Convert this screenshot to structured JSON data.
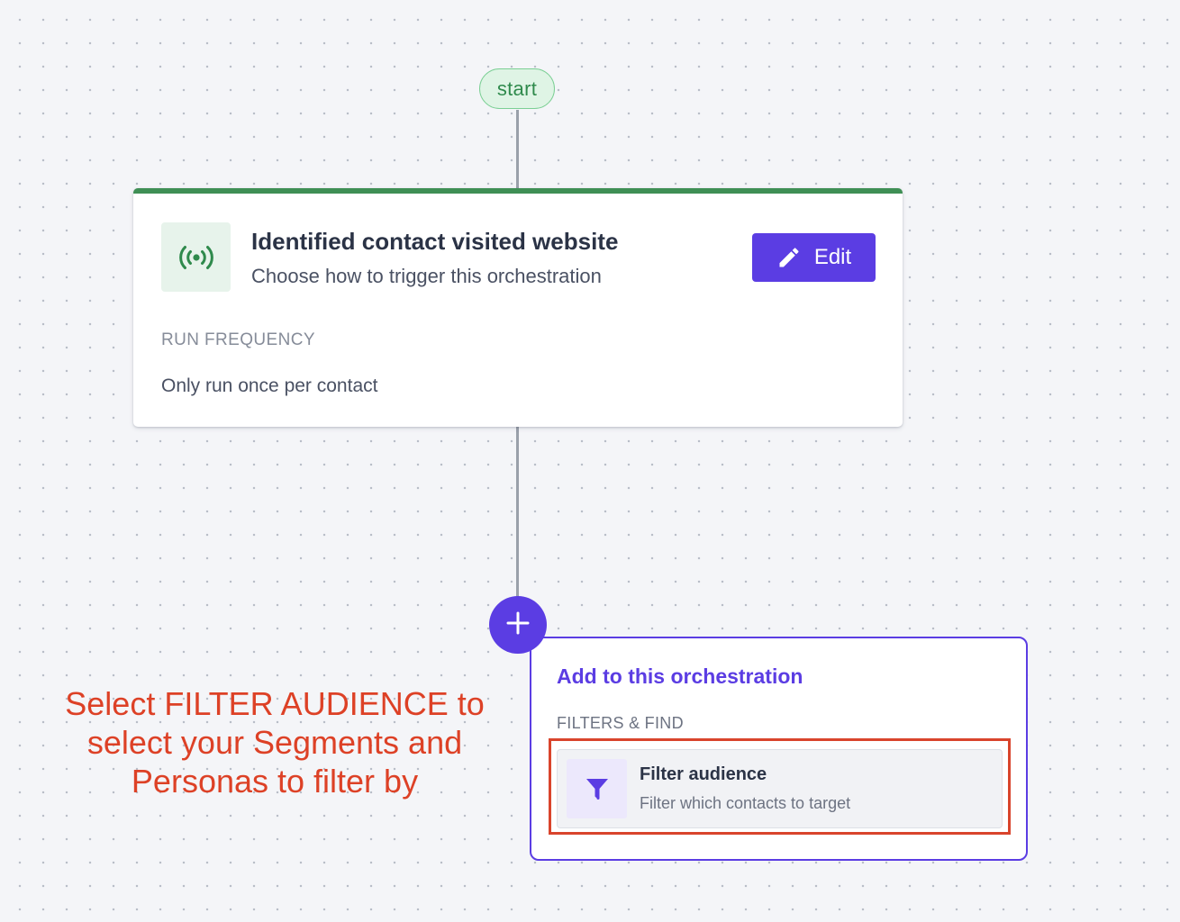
{
  "flow": {
    "start_label": "start"
  },
  "trigger": {
    "title": "Identified contact visited website",
    "subtitle": "Choose how to trigger this orchestration",
    "edit_label": "Edit",
    "run_frequency_label": "RUN FREQUENCY",
    "run_frequency_value": "Only run once per contact",
    "icon": "broadcast-icon",
    "accent_color": "#3f8f55"
  },
  "add_panel": {
    "title": "Add to this orchestration",
    "section_label": "FILTERS & FIND",
    "options": [
      {
        "title": "Filter audience",
        "description": "Filter which contacts to target",
        "icon": "funnel-icon"
      }
    ],
    "accent_color": "#5b3de3"
  },
  "annotation": {
    "lines": [
      "Select FILTER AUDIENCE to",
      "select your Segments and",
      "Personas to filter by"
    ],
    "color": "#dd4126"
  }
}
